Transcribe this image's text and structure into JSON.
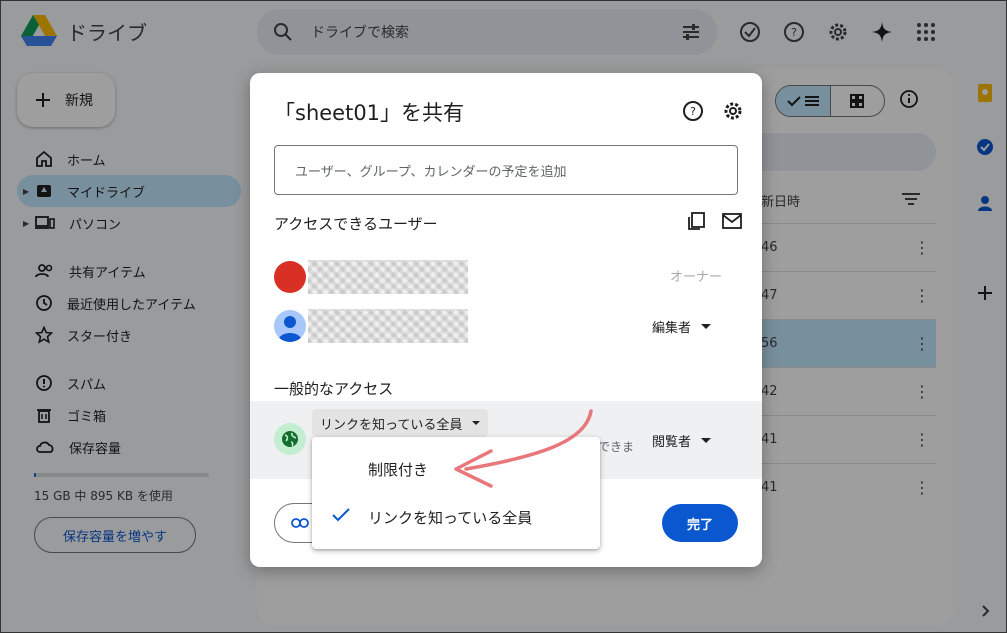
{
  "app": {
    "title": "ドライブ",
    "search_placeholder": "ドライブで検索",
    "new_label": "新規"
  },
  "sidebar": {
    "items": [
      {
        "label": "ホーム",
        "icon": "home-icon"
      },
      {
        "label": "マイドライブ",
        "icon": "my-drive-icon",
        "active": true
      },
      {
        "label": "パソコン",
        "icon": "computers-icon"
      },
      {
        "label": "共有アイテム",
        "icon": "shared-icon"
      },
      {
        "label": "最近使用したアイテム",
        "icon": "clock-icon"
      },
      {
        "label": "スター付き",
        "icon": "star-icon"
      },
      {
        "label": "スパム",
        "icon": "spam-icon"
      },
      {
        "label": "ゴミ箱",
        "icon": "trash-icon"
      },
      {
        "label": "保存容量",
        "icon": "cloud-icon"
      }
    ],
    "storage_text": "15 GB 中 895 KB を使用",
    "storage_button": "保存容量を増やす"
  },
  "file_list": {
    "column_header": "新日時",
    "rows": [
      "46",
      "47",
      "56",
      "42",
      "41",
      "41"
    ]
  },
  "dialog": {
    "title": "「sheet01」を共有",
    "add_placeholder": "ユーザー、グループ、カレンダーの予定を追加",
    "access_users_heading": "アクセスできるユーザー",
    "owner_label": "オーナー",
    "editor_role": "編集者",
    "general_access_heading": "一般的なアクセス",
    "access_select": "リンクを知っている全員",
    "trailing_text": "できま",
    "viewer_role": "閲覧者",
    "done_label": "完了"
  },
  "menu": {
    "items": [
      {
        "label": "制限付き",
        "checked": false
      },
      {
        "label": "リンクを知っている全員",
        "checked": true
      }
    ]
  },
  "colors": {
    "accent": "#0b57d0",
    "selected": "#c2e7ff",
    "annotation_arrow": "#e8777b"
  }
}
